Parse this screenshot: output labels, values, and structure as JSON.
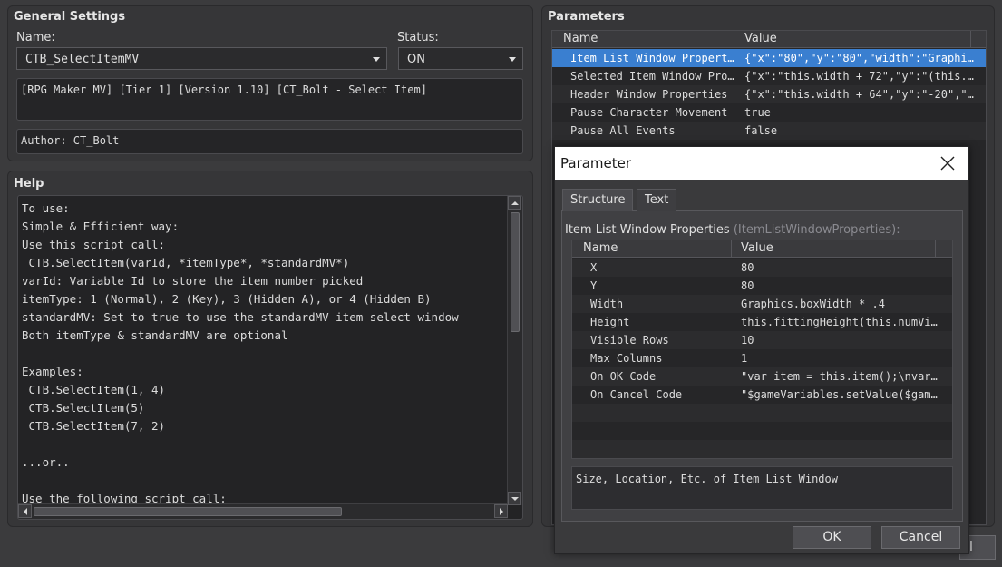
{
  "general": {
    "title": "General Settings",
    "name_label": "Name:",
    "name_value": "CTB_SelectItemMV",
    "status_label": "Status:",
    "status_value": "ON",
    "description": "[RPG Maker MV] [Tier 1] [Version 1.10] [CT_Bolt - Select Item]",
    "author": "Author: CT_Bolt"
  },
  "help": {
    "title": "Help",
    "lines": [
      "To use:",
      "Simple & Efficient way:",
      "Use this script call:",
      " CTB.SelectItem(varId, *itemType*, *standardMV*)",
      "varId: Variable Id to store the item number picked",
      "itemType: 1 (Normal), 2 (Key), 3 (Hidden A), or 4 (Hidden B)",
      "standardMV: Set to true to use the standardMV item select window",
      "Both itemType & standardMV are optional",
      "",
      "Examples:",
      " CTB.SelectItem(1, 4)",
      " CTB.SelectItem(5)",
      " CTB.SelectItem(7, 2)",
      "",
      "...or..",
      "",
      "Use the following script call:"
    ]
  },
  "parameters": {
    "title": "Parameters",
    "col_name": "Name",
    "col_value": "Value",
    "rows": [
      {
        "name": "Item List Window Propert…",
        "value": "{\"x\":\"80\",\"y\":\"80\",\"width\":\"Graphi…"
      },
      {
        "name": "Selected Item Window Pro…",
        "value": "{\"x\":\"this.width + 72\",\"y\":\"(this.…"
      },
      {
        "name": "Header Window Properties",
        "value": "{\"x\":\"this.width + 64\",\"y\":\"-20\",\"…"
      },
      {
        "name": "Pause Character Movement",
        "value": "true"
      },
      {
        "name": "Pause All Events",
        "value": "false"
      }
    ]
  },
  "dialog": {
    "title": "Parameter",
    "tab_structure": "Structure",
    "tab_text": "Text",
    "struct_label": "Item List Window Properties",
    "struct_type": "(ItemListWindowProperties):",
    "col_name": "Name",
    "col_value": "Value",
    "rows": [
      {
        "name": "X",
        "value": "80"
      },
      {
        "name": "Y",
        "value": "80"
      },
      {
        "name": "Width",
        "value": "Graphics.boxWidth * .4"
      },
      {
        "name": "Height",
        "value": "this.fittingHeight(this.numVi…"
      },
      {
        "name": "Visible Rows",
        "value": "10"
      },
      {
        "name": "Max Columns",
        "value": "1"
      },
      {
        "name": "On OK Code",
        "value": "\"var item = this.item();\\nvar…"
      },
      {
        "name": "On Cancel Code",
        "value": "\"$gameVariables.setValue($gam…"
      }
    ],
    "description": "Size, Location, Etc. of Item List Window",
    "ok_label": "OK",
    "cancel_label": "Cancel"
  },
  "background_button": {
    "label": "l"
  },
  "colors": {
    "selection": "#3a7fd0",
    "panel": "#363638",
    "background": "#3b3b3d"
  }
}
